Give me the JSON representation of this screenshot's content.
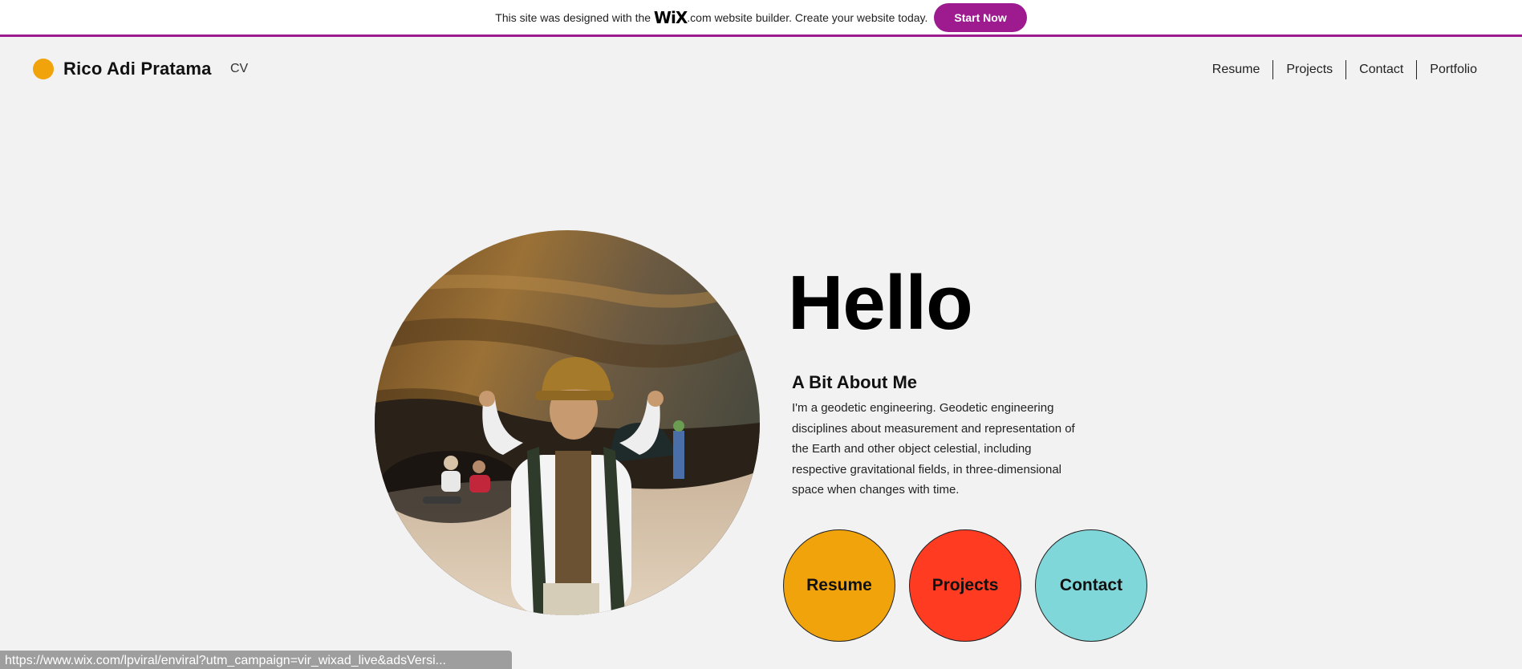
{
  "banner": {
    "text_before": "This site was designed with the",
    "logo_text": "WiX",
    "text_after": ".com website builder. Create your website today.",
    "cta_label": "Start Now",
    "accent_color": "#9d1a8f"
  },
  "header": {
    "brand_name": "Rico Adi Pratama",
    "brand_sub": "CV",
    "brand_dot_color": "#f0a30a",
    "nav": [
      "Resume",
      "Projects",
      "Contact",
      "Portfolio"
    ]
  },
  "hero": {
    "photo_icon": "profile-photo",
    "greeting": "Hello",
    "about_title": "A Bit About Me",
    "about_text": "I'm a geodetic engineering. Geodetic engineering disciplines about measurement and representation of the Earth and other object celestial, including respective gravitational fields, in three-dimensional space when changes with time."
  },
  "buttons": [
    {
      "label": "Resume",
      "color": "#f0a30a"
    },
    {
      "label": "Projects",
      "color": "#ff3b22"
    },
    {
      "label": "Contact",
      "color": "#7fd7da"
    }
  ],
  "status_bar": {
    "url": "https://www.wix.com/lpviral/enviral?utm_campaign=vir_wixad_live&adsVersi..."
  }
}
